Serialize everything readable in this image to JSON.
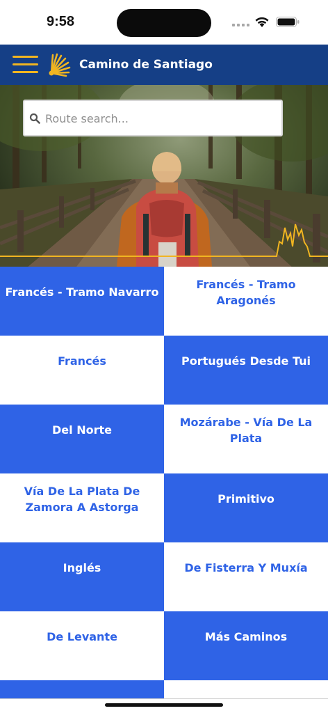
{
  "status_bar": {
    "time": "9:58"
  },
  "app_bar": {
    "title": "Camino de Santiago",
    "menu_icon": "hamburger-menu-icon",
    "logo_icon": "scallop-shell-icon",
    "brand_color": "#153f86",
    "accent_color": "#f1b521"
  },
  "search": {
    "placeholder": "Route search...",
    "value": ""
  },
  "routes": [
    {
      "label": "Francés - Tramo Navarro"
    },
    {
      "label": "Francés - Tramo Aragonés"
    },
    {
      "label": "Francés"
    },
    {
      "label": "Portugués Desde Tui"
    },
    {
      "label": "Del Norte"
    },
    {
      "label": "Mozárabe - Vía De La Plata"
    },
    {
      "label": "Vía De La Plata De Zamora A Astorga"
    },
    {
      "label": "Primitivo"
    },
    {
      "label": "Inglés"
    },
    {
      "label": "De Fisterra Y Muxía"
    },
    {
      "label": "De Levante"
    },
    {
      "label": "Más Caminos"
    }
  ],
  "colors": {
    "tile_blue": "#2f63e6",
    "tile_white": "#ffffff"
  }
}
